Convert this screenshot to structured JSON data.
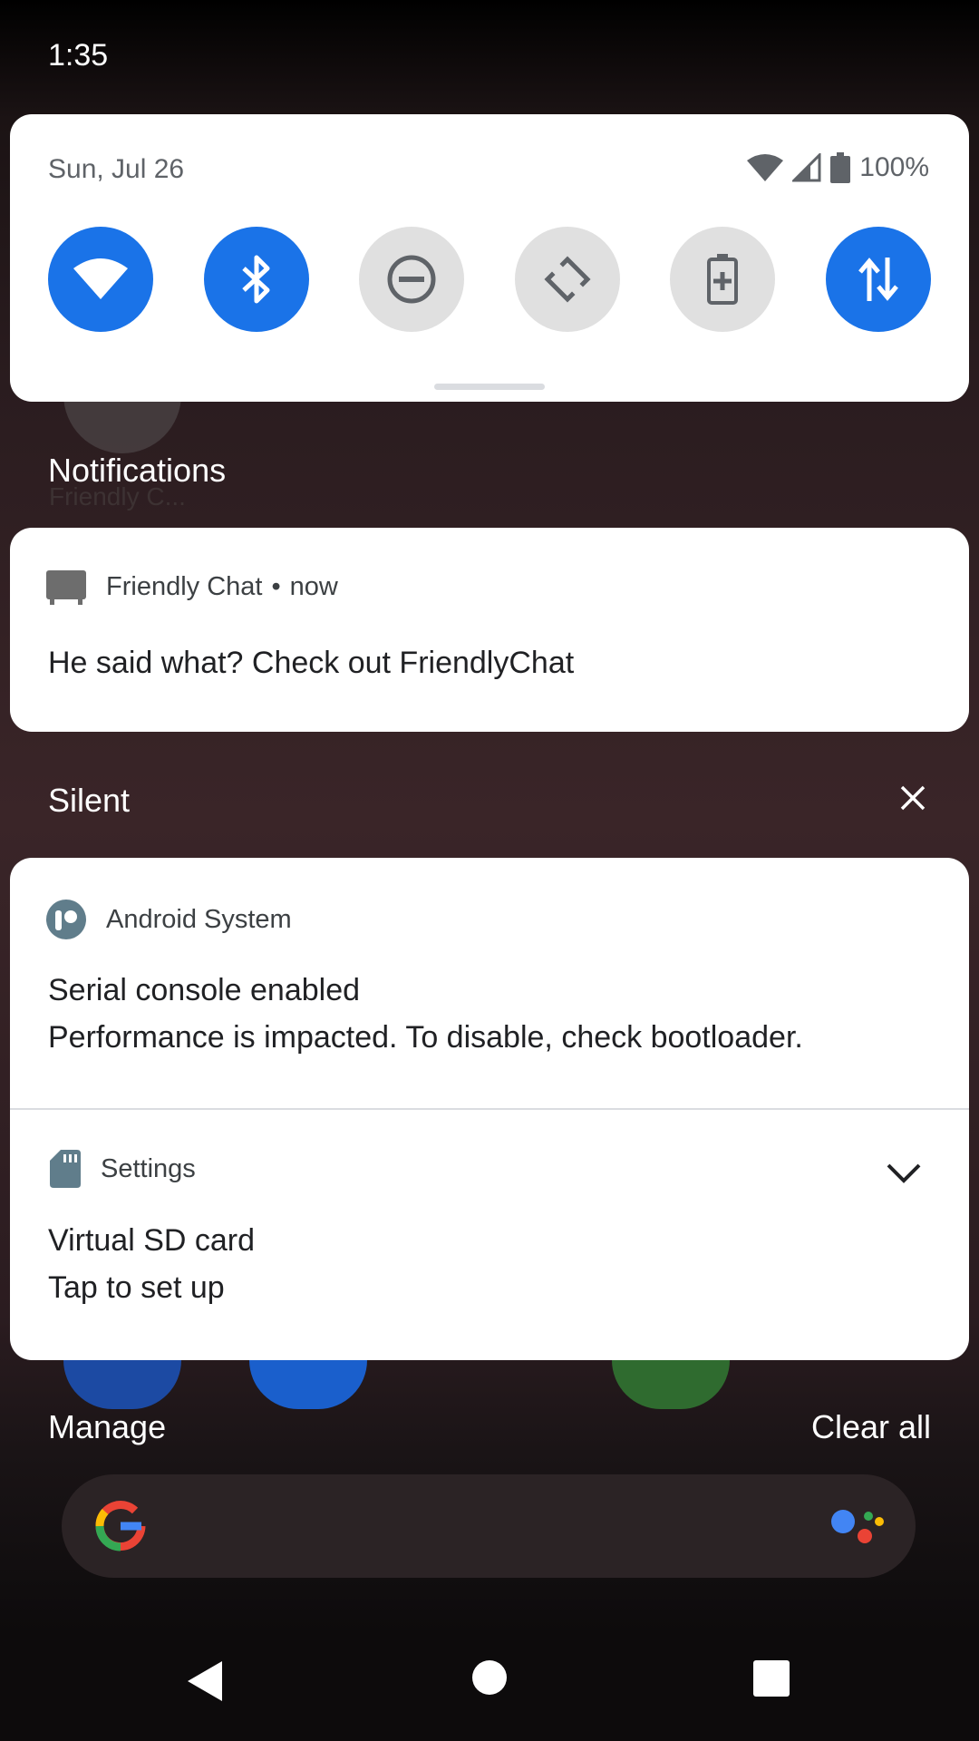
{
  "status_bar": {
    "time": "1:35"
  },
  "quick_settings": {
    "date": "Sun, Jul 26",
    "battery": "100%",
    "tiles": [
      {
        "name": "wifi",
        "state": "on"
      },
      {
        "name": "bluetooth",
        "state": "on"
      },
      {
        "name": "do-not-disturb",
        "state": "off"
      },
      {
        "name": "auto-rotate",
        "state": "off"
      },
      {
        "name": "battery-saver",
        "state": "off"
      },
      {
        "name": "mobile-data",
        "state": "on"
      }
    ]
  },
  "background": {
    "app_label": "Friendly C..."
  },
  "notifications": {
    "title": "Notifications",
    "friendly_chat": {
      "app": "Friendly Chat",
      "time": "now",
      "message": "He said what? Check out FriendlyChat"
    }
  },
  "silent": {
    "title": "Silent",
    "android_system": {
      "app": "Android System",
      "title": "Serial console enabled",
      "text": "Performance is impacted. To disable, check bootloader."
    },
    "settings": {
      "app": "Settings",
      "title": "Virtual SD card",
      "text": "Tap to set up"
    }
  },
  "actions": {
    "manage": "Manage",
    "clear_all": "Clear all"
  },
  "colors": {
    "accent": "#1a73e8",
    "tile_off": "#e0e0e0"
  }
}
